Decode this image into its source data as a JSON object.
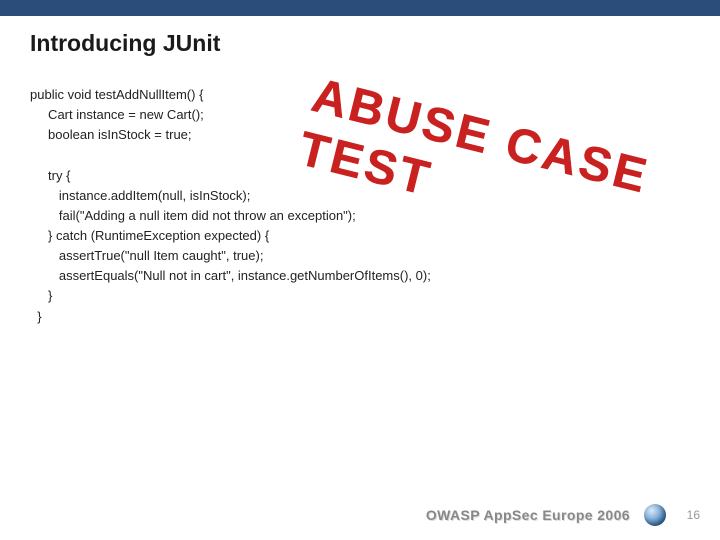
{
  "title": "Introducing JUnit",
  "stamp": "ABUSE CASE TEST",
  "code": [
    "public void testAddNullItem() {",
    "     Cart instance = new Cart();",
    "     boolean isInStock = true;",
    "",
    "     try {",
    "        instance.addItem(null, isInStock);",
    "        fail(\"Adding a null item did not throw an exception\");",
    "     } catch (RuntimeException expected) {",
    "        assertTrue(\"null Item caught\", true);",
    "        assertEquals(\"Null not in cart\", instance.getNumberOfItems(), 0);",
    "     }",
    "  }"
  ],
  "footer": {
    "text": "OWASP AppSec Europe 2006",
    "page": "16"
  }
}
